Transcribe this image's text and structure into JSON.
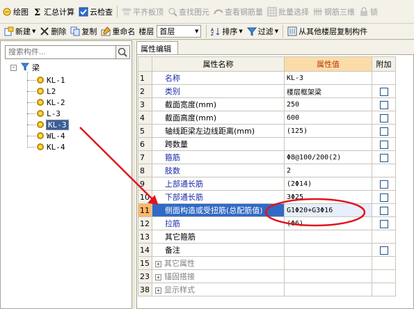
{
  "toolbar1": {
    "items": [
      {
        "label": "绘图",
        "icon": "draw-icon",
        "disabled": false
      },
      {
        "label": "汇总计算",
        "icon": "sigma-icon",
        "disabled": false
      },
      {
        "label": "云检查",
        "icon": "cloud-check-icon",
        "disabled": false
      },
      {
        "label": "平齐板顶",
        "icon": "align-top-icon",
        "disabled": true
      },
      {
        "label": "查找图元",
        "icon": "find-element-icon",
        "disabled": true
      },
      {
        "label": "查看钢筋量",
        "icon": "view-rebar-icon",
        "disabled": true
      },
      {
        "label": "批量选择",
        "icon": "batch-select-icon",
        "disabled": true
      },
      {
        "label": "钢筋三维",
        "icon": "rebar-3d-icon",
        "disabled": true
      },
      {
        "label": "锁",
        "icon": "lock-icon",
        "disabled": true
      }
    ]
  },
  "toolbar2": {
    "new_label": "新建",
    "delete_label": "删除",
    "copy_label": "复制",
    "rename_label": "重命名",
    "floor_label": "楼层",
    "floor_value": "首层",
    "sort_label": "排序",
    "filter_label": "过滤",
    "copy_from_floor_label": "从其他楼层复制构件"
  },
  "left": {
    "search_placeholder": "搜索构件...",
    "tree_root": "梁",
    "tree_items": [
      "KL-1",
      "L2",
      "KL-2",
      "L-3",
      "KL-3",
      "WL-4",
      "KL-4"
    ],
    "selected_index": 4
  },
  "right": {
    "tab_label": "属性编辑",
    "headers": {
      "name": "属性名称",
      "value": "属性值",
      "extra": "附加"
    },
    "rows": [
      {
        "num": "1",
        "name": "名称",
        "value": "KL-3",
        "style": "blue",
        "checkbox": false
      },
      {
        "num": "2",
        "name": "类别",
        "value": "楼层框架梁",
        "style": "blue",
        "checkbox": true
      },
      {
        "num": "3",
        "name": "截面宽度(mm)",
        "value": "250",
        "style": "black",
        "checkbox": true
      },
      {
        "num": "4",
        "name": "截面高度(mm)",
        "value": "600",
        "style": "black",
        "checkbox": true
      },
      {
        "num": "5",
        "name": "轴线距梁左边线距离(mm)",
        "value": "(125)",
        "style": "black",
        "checkbox": true
      },
      {
        "num": "6",
        "name": "跨数量",
        "value": "",
        "style": "black",
        "checkbox": true
      },
      {
        "num": "7",
        "name": "箍筋",
        "value": "Φ8@100/200(2)",
        "style": "blue",
        "checkbox": true
      },
      {
        "num": "8",
        "name": "肢数",
        "value": "2",
        "style": "blue",
        "checkbox": false
      },
      {
        "num": "9",
        "name": "上部通长筋",
        "value": "(2Φ14)",
        "style": "blue",
        "checkbox": true
      },
      {
        "num": "10",
        "name": "下部通长筋",
        "value": "3Φ25",
        "style": "blue",
        "checkbox": true
      },
      {
        "num": "11",
        "name": "侧面构造或受扭筋(总配筋值)",
        "value": "G1Φ20+G3Φ16",
        "style": "highlight",
        "checkbox": true
      },
      {
        "num": "12",
        "name": "拉筋",
        "value": "(Φ6)",
        "style": "blue",
        "checkbox": true
      },
      {
        "num": "13",
        "name": "其它箍筋",
        "value": "",
        "style": "black",
        "checkbox": false
      },
      {
        "num": "14",
        "name": "备注",
        "value": "",
        "style": "black",
        "checkbox": true
      },
      {
        "num": "15",
        "name": "其它属性",
        "value": "",
        "style": "group",
        "checkbox": false
      },
      {
        "num": "23",
        "name": "锚固搭接",
        "value": "",
        "style": "group",
        "checkbox": false
      },
      {
        "num": "38",
        "name": "显示样式",
        "value": "",
        "style": "group",
        "checkbox": false
      }
    ]
  },
  "colors": {
    "annotation_red": "#e0141e",
    "selection_blue": "#316ac5",
    "header_orange": "#fbdca9"
  }
}
